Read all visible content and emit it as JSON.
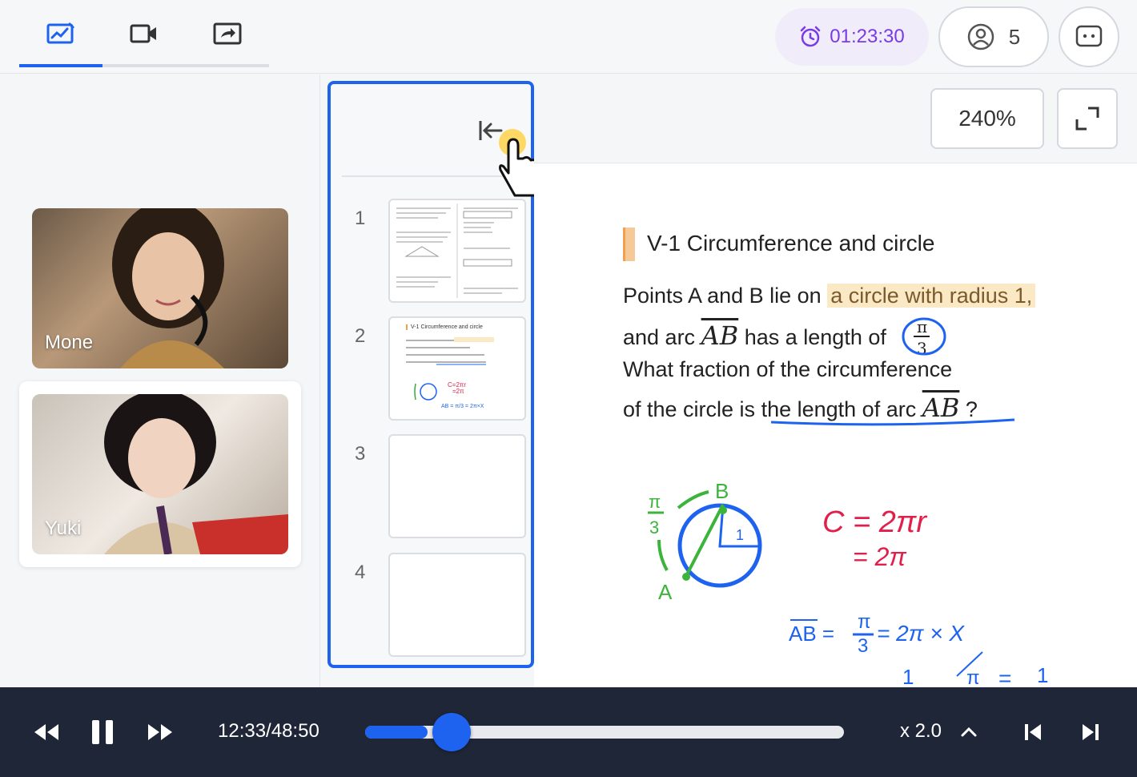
{
  "toolbar": {
    "tabs": [
      {
        "icon": "whiteboard-icon",
        "active": true
      },
      {
        "icon": "video-camera-icon",
        "active": false
      },
      {
        "icon": "screen-share-icon",
        "active": false
      }
    ],
    "timer": "01:23:30",
    "participants_count": "5",
    "accent_color": "#1e63f0",
    "timer_color": "#7a3be6"
  },
  "participants": [
    {
      "name": "Mone"
    },
    {
      "name": "Yuki"
    }
  ],
  "thumbnails": [
    {
      "number": "1"
    },
    {
      "number": "2",
      "title": "V-1 Circumference and circle"
    },
    {
      "number": "3"
    },
    {
      "number": "4"
    }
  ],
  "viewer": {
    "zoom": "240%",
    "title": "V-1 Circumference and circle",
    "line1_a": "Points A and B lie on",
    "line1_hl": "a circle with radius 1,",
    "line2_a": "and arc",
    "arc": "AB",
    "line2_b": "has a length of",
    "line3": "What fraction of the circumference",
    "line4_a": "of the circle is",
    "line4_u": "the length of arc",
    "line4_end": "?",
    "annotations": {
      "formula1": "C = 2πr",
      "formula2": "= 2π",
      "formula3": "AB = π/3 = 2π × X",
      "label_b": "B",
      "label_a": "A",
      "label_one": "1",
      "arc_label": "π/3"
    }
  },
  "player": {
    "time": "12:33/48:50",
    "progress": 0.13,
    "speed": "x 2.0"
  }
}
